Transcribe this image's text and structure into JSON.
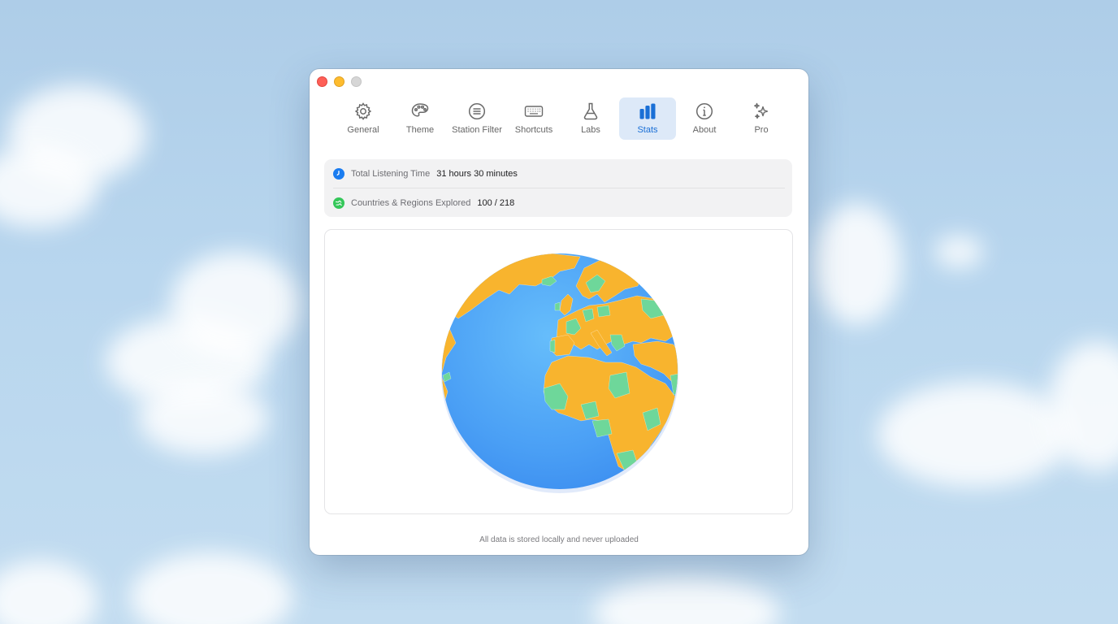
{
  "window": {
    "controls": [
      "close",
      "minimize",
      "zoom"
    ]
  },
  "toolbar": {
    "tabs": [
      {
        "label": "General",
        "icon": "gear-icon",
        "active": false
      },
      {
        "label": "Theme",
        "icon": "palette-icon",
        "active": false
      },
      {
        "label": "Station Filter",
        "icon": "filter-list-icon",
        "active": false
      },
      {
        "label": "Shortcuts",
        "icon": "keyboard-icon",
        "active": false
      },
      {
        "label": "Labs",
        "icon": "flask-icon",
        "active": false
      },
      {
        "label": "Stats",
        "icon": "bar-chart-icon",
        "active": true
      },
      {
        "label": "About",
        "icon": "info-icon",
        "active": false
      },
      {
        "label": "Pro",
        "icon": "sparkles-icon",
        "active": false
      }
    ]
  },
  "stats": {
    "listening": {
      "label": "Total Listening Time",
      "value": "31 hours 30 minutes",
      "icon": "clock-icon",
      "color": "#1a7cf0"
    },
    "countries": {
      "label": "Countries & Regions Explored",
      "value": "100 / 218",
      "icon": "globe-icon",
      "color": "#34c759"
    }
  },
  "globe": {
    "ocean_color": "#4ea3f7",
    "unexplored_color": "#f8b42e",
    "explored_color": "#6ed79a"
  },
  "footer": {
    "note": "All data is stored locally and never uploaded"
  }
}
